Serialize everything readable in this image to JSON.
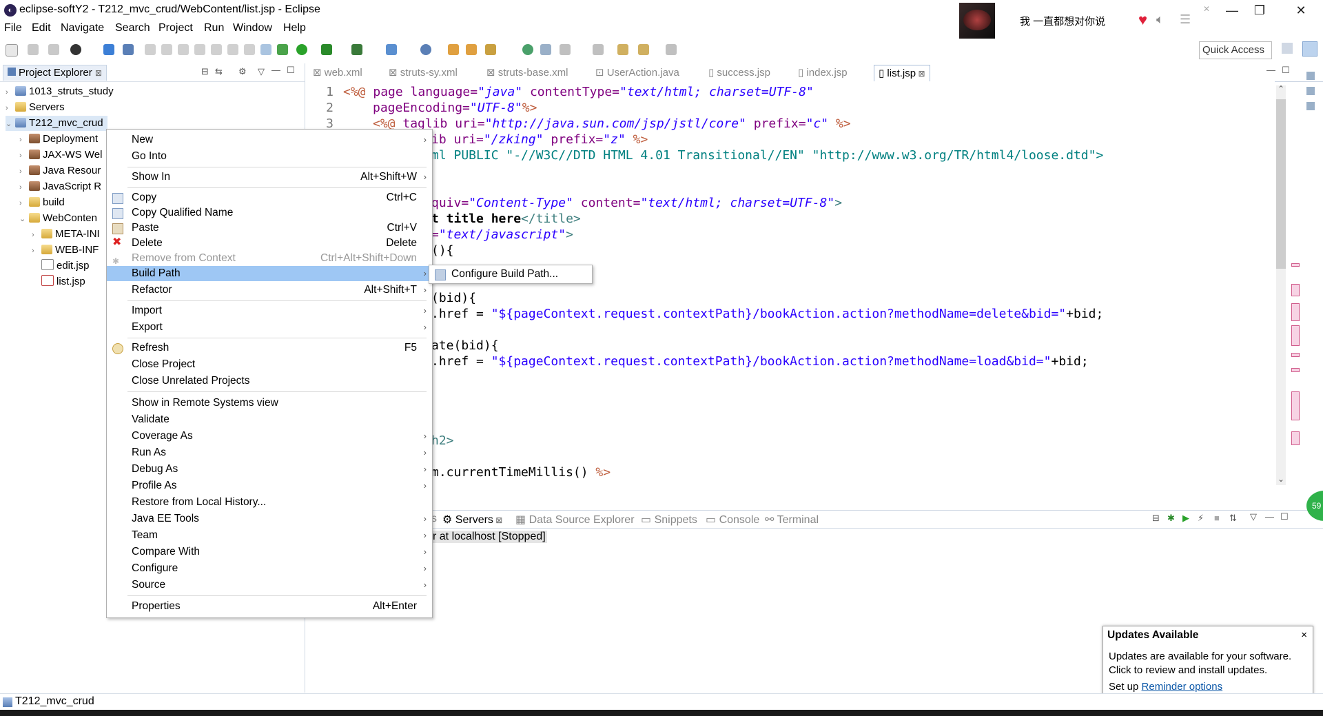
{
  "window": {
    "title": "eclipse-softY2 - T212_mvc_crud/WebContent/list.jsp - Eclipse",
    "min_icon": "minimize-icon",
    "max_icon": "restore-icon",
    "close_icon": "close-icon"
  },
  "music_widget": {
    "song": "我 一直都想对你说"
  },
  "menubar": [
    "File",
    "Edit",
    "Navigate",
    "Search",
    "Project",
    "Run",
    "Window",
    "Help"
  ],
  "quick_access": "Quick Access",
  "project_explorer": {
    "title": "Project Explorer",
    "tree": [
      {
        "label": "1013_struts_study",
        "arrow": "›"
      },
      {
        "label": "Servers",
        "arrow": "›"
      },
      {
        "label": "T212_mvc_crud",
        "arrow": "⌄"
      },
      {
        "label": "Deployment",
        "arrow": "›"
      },
      {
        "label": "JAX-WS Wel",
        "arrow": "›"
      },
      {
        "label": "Java Resour",
        "arrow": "›"
      },
      {
        "label": "JavaScript R",
        "arrow": "›"
      },
      {
        "label": "build",
        "arrow": "›"
      },
      {
        "label": "WebConten",
        "arrow": "⌄"
      },
      {
        "label": "META-INI",
        "arrow": "›"
      },
      {
        "label": "WEB-INF",
        "arrow": "›"
      },
      {
        "label": "edit.jsp",
        "arrow": ""
      },
      {
        "label": "list.jsp",
        "arrow": ""
      }
    ]
  },
  "editor_tabs": [
    "web.xml",
    "struts-sy.xml",
    "struts-base.xml",
    "UserAction.java",
    "success.jsp",
    "index.jsp",
    "list.jsp"
  ],
  "editor_code": {
    "ln1": "1",
    "ln2": "2",
    "ln3": "3",
    "l1": {
      "a": "<%@",
      "b": " page ",
      "c": "language=",
      "d": "\"java\"",
      "e": " contentType=",
      "f": "\"text/html; charset=UTF-8\""
    },
    "l2": {
      "a": "pageEncoding=",
      "b": "\"UTF-8\"",
      "c": "%>"
    },
    "l3": {
      "a": "<%@",
      "b": " taglib ",
      "c": "uri=",
      "d": "\"http://java.sun.com/jsp/jstl/core\"",
      "e": " prefix=",
      "f": "\"c\"",
      "g": " %>"
    },
    "l4": {
      "a": "ib ",
      "b": "uri=",
      "c": "\"/zking\"",
      "d": " prefix=",
      "e": "\"z\"",
      "f": " %>"
    },
    "l5": "ml PUBLIC \"-//W3C//DTD HTML 4.01 Transitional//EN\" \"http://www.w3.org/TR/html4/loose.dtd\">",
    "l8": {
      "a": "quiv=",
      "b": "\"Content-Type\"",
      "c": " content=",
      "d": "\"text/html; charset=UTF-8\"",
      "e": ">"
    },
    "l9": {
      "a": "t title here",
      "b": "</title>"
    },
    "l10": {
      "a": "=",
      "b": "\"text/javascript\"",
      "c": ">"
    },
    "l11": "(){",
    "l14": "(bid){",
    "l15": {
      "a": ".href = ",
      "b": "\"${pageContext.request.contextPath}/bookAction.action?methodName=delete&bid=\"",
      "c": "+bid;"
    },
    "l17": "ate(bid){",
    "l18": {
      "a": ".href = ",
      "b": "\"${pageContext.request.contextPath}/bookAction.action?methodName=load&bid=\"",
      "c": "+bid;"
    },
    "l23": "h2>",
    "l25": {
      "a": "m.currentTimeMillis() ",
      "b": "%>"
    }
  },
  "bottom_panel": {
    "tabs": [
      "s",
      "Servers",
      "Data Source Explorer",
      "Snippets",
      "Console",
      "Terminal"
    ],
    "server_row": "r at localhost  [Stopped]"
  },
  "context_menu": {
    "items": [
      {
        "label": "New",
        "shortcut": "",
        "submenu": true
      },
      {
        "label": "Go Into",
        "shortcut": "",
        "submenu": false
      },
      {
        "label": "Show In",
        "shortcut": "Alt+Shift+W",
        "submenu": true
      },
      {
        "label": "Copy",
        "shortcut": "Ctrl+C",
        "submenu": false
      },
      {
        "label": "Copy Qualified Name",
        "shortcut": "",
        "submenu": false
      },
      {
        "label": "Paste",
        "shortcut": "Ctrl+V",
        "submenu": false
      },
      {
        "label": "Delete",
        "shortcut": "Delete",
        "submenu": false
      },
      {
        "label": "Remove from Context",
        "shortcut": "Ctrl+Alt+Shift+Down",
        "submenu": false,
        "disabled": true
      },
      {
        "label": "Build Path",
        "shortcut": "",
        "submenu": true,
        "highlighted": true
      },
      {
        "label": "Refactor",
        "shortcut": "Alt+Shift+T",
        "submenu": true
      },
      {
        "label": "Import",
        "shortcut": "",
        "submenu": true
      },
      {
        "label": "Export",
        "shortcut": "",
        "submenu": true
      },
      {
        "label": "Refresh",
        "shortcut": "F5",
        "submenu": false
      },
      {
        "label": "Close Project",
        "shortcut": "",
        "submenu": false
      },
      {
        "label": "Close Unrelated Projects",
        "shortcut": "",
        "submenu": false
      },
      {
        "label": "Show in Remote Systems view",
        "shortcut": "",
        "submenu": false
      },
      {
        "label": "Validate",
        "shortcut": "",
        "submenu": false
      },
      {
        "label": "Coverage As",
        "shortcut": "",
        "submenu": true
      },
      {
        "label": "Run As",
        "shortcut": "",
        "submenu": true
      },
      {
        "label": "Debug As",
        "shortcut": "",
        "submenu": true
      },
      {
        "label": "Profile As",
        "shortcut": "",
        "submenu": true
      },
      {
        "label": "Restore from Local History...",
        "shortcut": "",
        "submenu": false
      },
      {
        "label": "Java EE Tools",
        "shortcut": "",
        "submenu": true
      },
      {
        "label": "Team",
        "shortcut": "",
        "submenu": true
      },
      {
        "label": "Compare With",
        "shortcut": "",
        "submenu": true
      },
      {
        "label": "Configure",
        "shortcut": "",
        "submenu": true
      },
      {
        "label": "Source",
        "shortcut": "",
        "submenu": true
      },
      {
        "label": "Properties",
        "shortcut": "Alt+Enter",
        "submenu": false
      }
    ],
    "submenu_item": "Configure Build Path..."
  },
  "updates_popup": {
    "title": "Updates Available",
    "close": "×",
    "line1": "Updates are available for your software.",
    "line2": "Click to review and install updates.",
    "line3_prefix": "Set up ",
    "link": "Reminder options"
  },
  "status_bar": {
    "project": "T212_mvc_crud"
  },
  "green_badge": "59",
  "colors": {
    "menu_highlight": "#9ec7f4",
    "keyword": "#7f007f",
    "string": "#2a00ff",
    "jsp_tag": "#bf5f3f"
  }
}
